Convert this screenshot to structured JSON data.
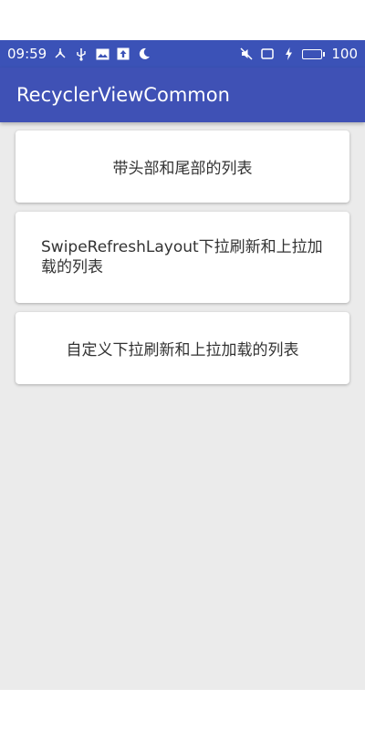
{
  "status_bar": {
    "time": "09:59",
    "battery_level": "100",
    "left_icons": [
      "usb-share-icon",
      "usb-icon",
      "image-icon",
      "upload-icon",
      "moon-icon"
    ],
    "right_icons": [
      "mute-icon",
      "rotation-icon",
      "charging-icon",
      "battery-icon"
    ]
  },
  "app_bar": {
    "title": "RecyclerViewCommon"
  },
  "list": {
    "items": [
      {
        "label": "带头部和尾部的列表"
      },
      {
        "label": "SwipeRefreshLayout下拉刷新和上拉加载的列表"
      },
      {
        "label": "自定义下拉刷新和上拉加载的列表"
      }
    ]
  },
  "colors": {
    "primary": "#3f51b5",
    "status_bar": "#3b52b7",
    "background": "#ebebeb",
    "card": "#ffffff",
    "text": "#333333"
  }
}
